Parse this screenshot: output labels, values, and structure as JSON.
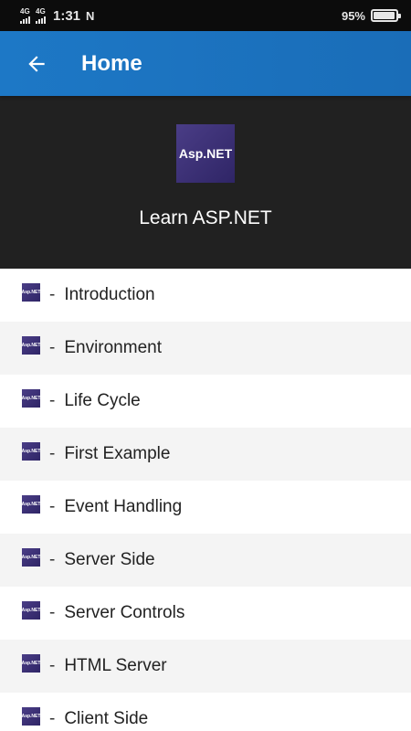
{
  "status_bar": {
    "network_1": "4G",
    "network_2": "4G",
    "time": "1:31",
    "nfc": "N",
    "battery_percent": "95%",
    "battery_level": 0.95
  },
  "app_bar": {
    "back_icon": "arrow-left-icon",
    "title": "Home",
    "color": "#1d78c6"
  },
  "banner": {
    "logo_text": "Asp.NET",
    "title": "Learn ASP.NET",
    "background": "#212121"
  },
  "list": {
    "icon_text": "Asp.NET",
    "dash": "-",
    "items": [
      {
        "label": "Introduction"
      },
      {
        "label": "Environment"
      },
      {
        "label": "Life Cycle"
      },
      {
        "label": "First Example"
      },
      {
        "label": "Event Handling"
      },
      {
        "label": "Server Side"
      },
      {
        "label": "Server Controls"
      },
      {
        "label": "HTML Server"
      },
      {
        "label": "Client Side"
      }
    ]
  }
}
